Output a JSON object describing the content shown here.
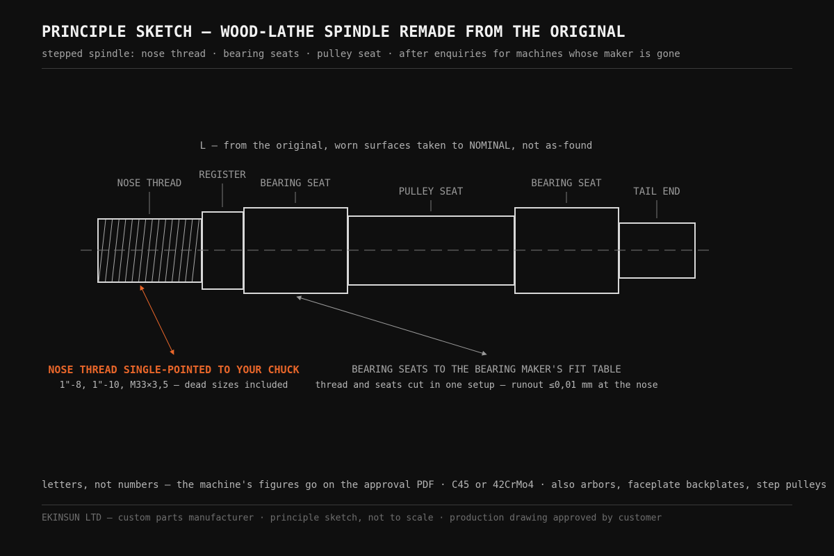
{
  "header": {
    "title": "PRINCIPLE SKETCH — WOOD-LATHE SPINDLE REMADE FROM THE ORIGINAL",
    "subtitle": "stepped spindle: nose thread · bearing seats · pulley seat · after enquiries for machines whose maker is gone"
  },
  "diagram": {
    "length_note": "L — from the original, worn surfaces taken to NOMINAL, not as-found",
    "labels": {
      "nose_thread": "NOSE THREAD",
      "register": "REGISTER",
      "bearing_seat_1": "BEARING SEAT",
      "pulley_seat": "PULLEY SEAT",
      "bearing_seat_2": "BEARING SEAT",
      "tail_end": "TAIL END"
    },
    "callout_thread": {
      "title": "NOSE THREAD SINGLE-POINTED TO YOUR CHUCK",
      "detail": "1\"-8, 1\"-10, M33×3,5 — dead sizes included"
    },
    "callout_bearing": {
      "title": "BEARING SEATS TO THE BEARING MAKER'S FIT TABLE",
      "detail": "thread and seats cut in one setup — runout ≤0,01 mm at the nose"
    },
    "colors": {
      "accent": "#e8662a",
      "outline": "#d8d8d8",
      "muted": "#9a9a9a"
    }
  },
  "note": "letters, not numbers — the machine's figures go on the approval PDF · C45 or 42CrMo4 · also arbors, faceplate backplates, step pulleys",
  "footer": "EKINSUN LTD — custom parts manufacturer · principle sketch, not to scale · production drawing approved by customer"
}
